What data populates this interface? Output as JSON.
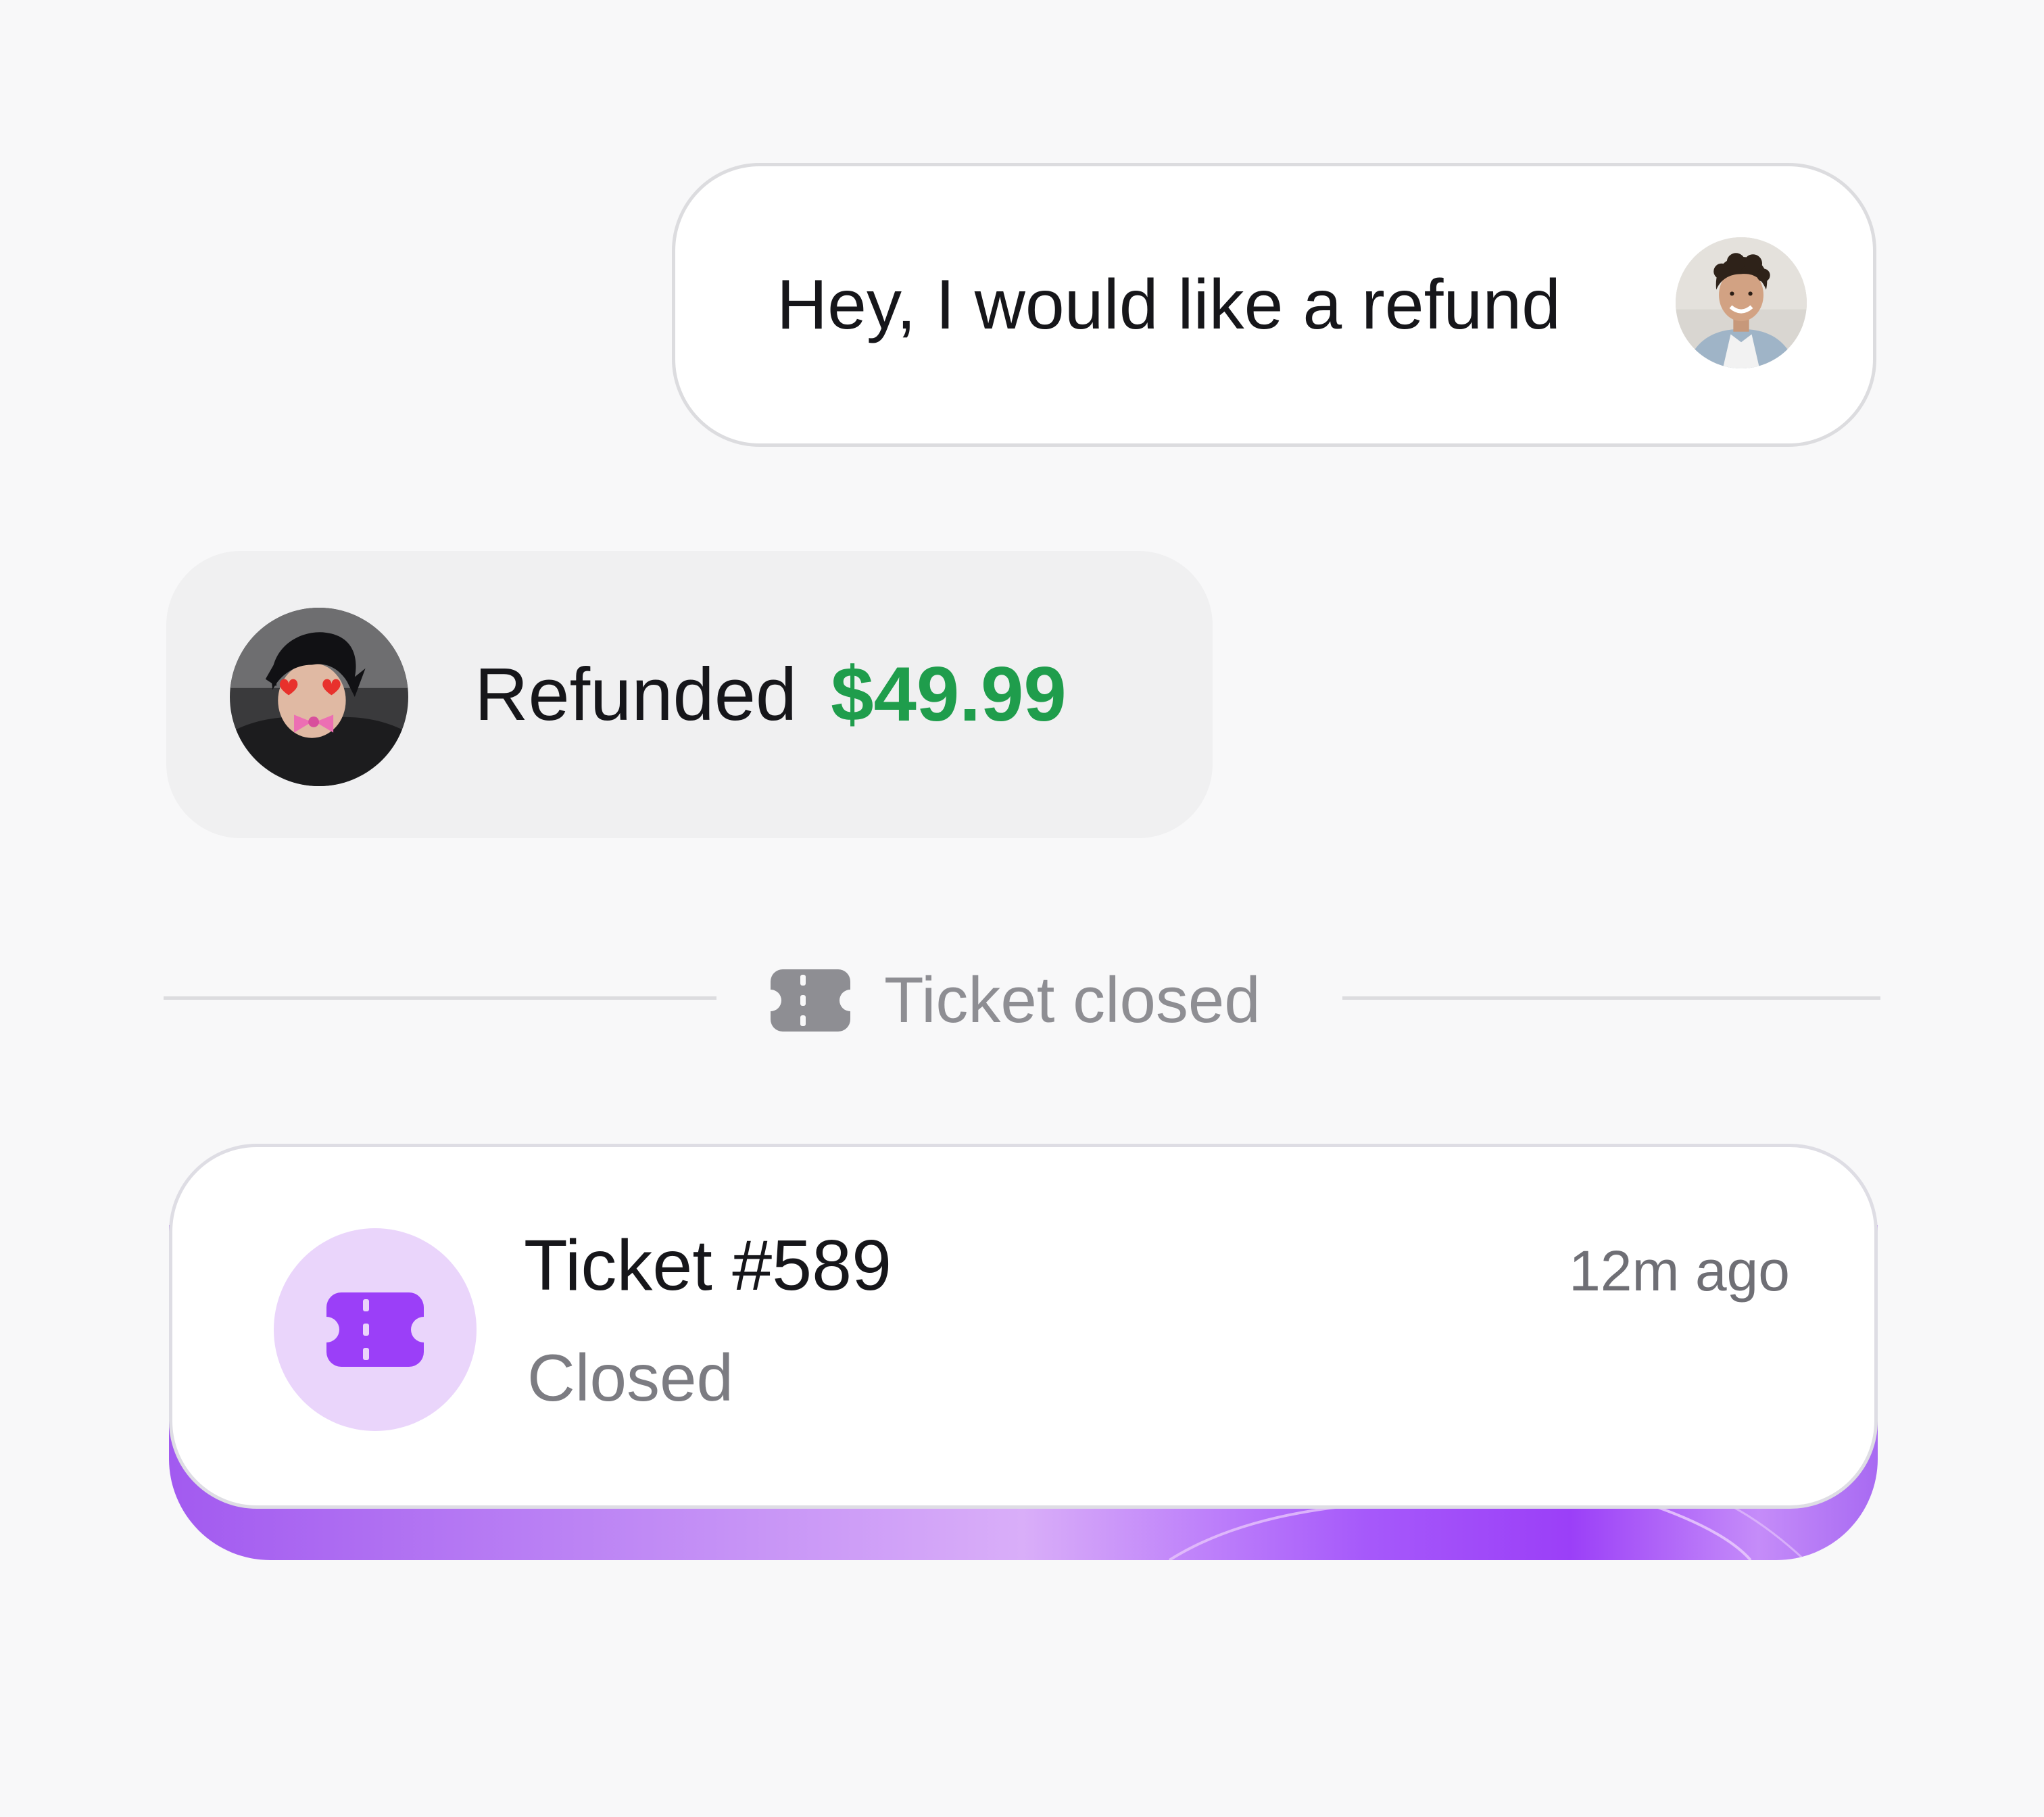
{
  "conversation": {
    "customer_message": {
      "text": "Hey, I would like a refund",
      "avatar": "customer-avatar-photo"
    },
    "agent_message": {
      "label": "Refunded",
      "amount": "$49.99",
      "amount_color": "#1f9d4c",
      "avatar": "agent-avatar-photo"
    },
    "divider": {
      "icon": "ticket-icon",
      "text": "Ticket closed"
    }
  },
  "ticket": {
    "icon": "ticket-icon",
    "title": "Ticket #589",
    "status": "Closed",
    "time": "12m ago",
    "accent_color": "#9b3ff8",
    "icon_bg_color": "#ead5fb"
  }
}
